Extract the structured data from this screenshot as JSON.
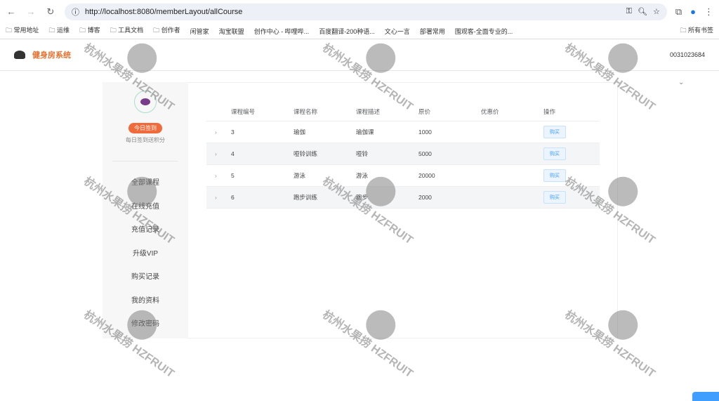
{
  "browser": {
    "url": "http://localhost:8080/memberLayout/allCourse",
    "bookmarks": [
      "常用地址",
      "运维",
      "博客",
      "工具文档",
      "创作者",
      "闲管家",
      "淘宝联盟",
      "创作中心 - 哔哩哔...",
      "百度翻译-200种语...",
      "文心一言",
      "部署常用",
      "围观客-全面专业的..."
    ],
    "all_bookmarks": "所有书签"
  },
  "header": {
    "brand": "健身房系统",
    "user": "0031023684"
  },
  "sidebar": {
    "checkin": "今日签到",
    "checkin_tip": "每日签到送积分",
    "items": [
      "全部课程",
      "在线充值",
      "充值记录",
      "升级VIP",
      "购买记录",
      "我的资料",
      "修改密码"
    ]
  },
  "table": {
    "headers": [
      "课程编号",
      "课程名称",
      "课程描述",
      "原价",
      "优惠价",
      "操作"
    ],
    "rows": [
      {
        "id": "3",
        "name": "瑜伽",
        "desc": "瑜伽课",
        "price": "1000",
        "discount": "",
        "action": "购买"
      },
      {
        "id": "4",
        "name": "哑铃训练",
        "desc": "哑铃",
        "price": "5000",
        "discount": "",
        "action": "购买"
      },
      {
        "id": "5",
        "name": "游泳",
        "desc": "游泳",
        "price": "20000",
        "discount": "",
        "action": "购买"
      },
      {
        "id": "6",
        "name": "跑步训练",
        "desc": "跑步",
        "price": "2000",
        "discount": "",
        "action": "购买"
      }
    ]
  },
  "watermark": "杭州水果捞 HZFRUIT"
}
